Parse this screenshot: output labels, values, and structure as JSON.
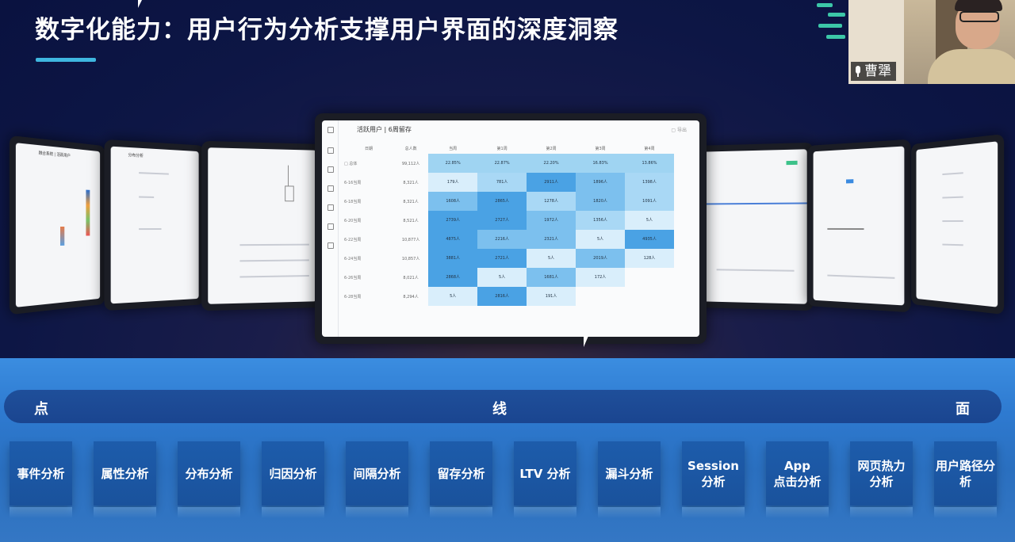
{
  "slide": {
    "title": "数字化能力：用户行为分析支撑用户界面的深度洞察",
    "accent_color": "#3fb7e0"
  },
  "video": {
    "participant_name": "曹犟",
    "mic_icon": "microphone-icon"
  },
  "main_device": {
    "header_title": "活跃用户 | 6周留存",
    "header_right": "▢ 导出",
    "table": {
      "headers": [
        "日期",
        "总人数",
        "当周",
        "第1周",
        "第2周",
        "第3周",
        "第4周"
      ],
      "rows": [
        {
          "label": "□ 总体",
          "total": "99,112人",
          "cells": [
            "22.85%",
            "22.87%",
            "22.20%",
            "16.83%",
            "13.86%"
          ]
        },
        {
          "label": "6-16当周",
          "total": "8,321人",
          "cells": [
            "179人",
            "781人",
            "2911人",
            "1896人",
            "1398人"
          ]
        },
        {
          "label": "6-18当周",
          "total": "8,321人",
          "cells": [
            "1608人",
            "2865人",
            "1278人",
            "1820人",
            "1091人"
          ]
        },
        {
          "label": "6-20当周",
          "total": "8,521人",
          "cells": [
            "2739人",
            "2727人",
            "1972人",
            "1356人",
            "5人"
          ]
        },
        {
          "label": "6-22当周",
          "total": "10,877人",
          "cells": [
            "4875人",
            "2216人",
            "2321人",
            "5人",
            "4935人"
          ]
        },
        {
          "label": "6-24当周",
          "total": "10,857人",
          "cells": [
            "3881人",
            "2721人",
            "5人",
            "2019人",
            "128人"
          ]
        },
        {
          "label": "6-26当周",
          "total": "8,021人",
          "cells": [
            "2868人",
            "5人",
            "1681人",
            "172人",
            ""
          ]
        },
        {
          "label": "6-28当周",
          "total": "8,294人",
          "cells": [
            "5人",
            "2816人",
            "191人",
            "",
            ""
          ]
        }
      ]
    }
  },
  "side_devices": {
    "left1_title": "融合系统 | 活跃用户",
    "left2_title": "分布分析"
  },
  "bottom": {
    "pill_left": "点",
    "pill_center": "线",
    "pill_right": "面",
    "cards": [
      {
        "label": "事件分析"
      },
      {
        "label": "属性分析"
      },
      {
        "label": "分布分析"
      },
      {
        "label": "归因分析"
      },
      {
        "label": "间隔分析"
      },
      {
        "label": "留存分析"
      },
      {
        "label": "LTV 分析"
      },
      {
        "label": "漏斗分析"
      },
      {
        "label": "Session\n分析"
      },
      {
        "label": "App\n点击分析"
      },
      {
        "label": "网页热力\n分析"
      },
      {
        "label": "用户路径分\n析"
      }
    ]
  }
}
